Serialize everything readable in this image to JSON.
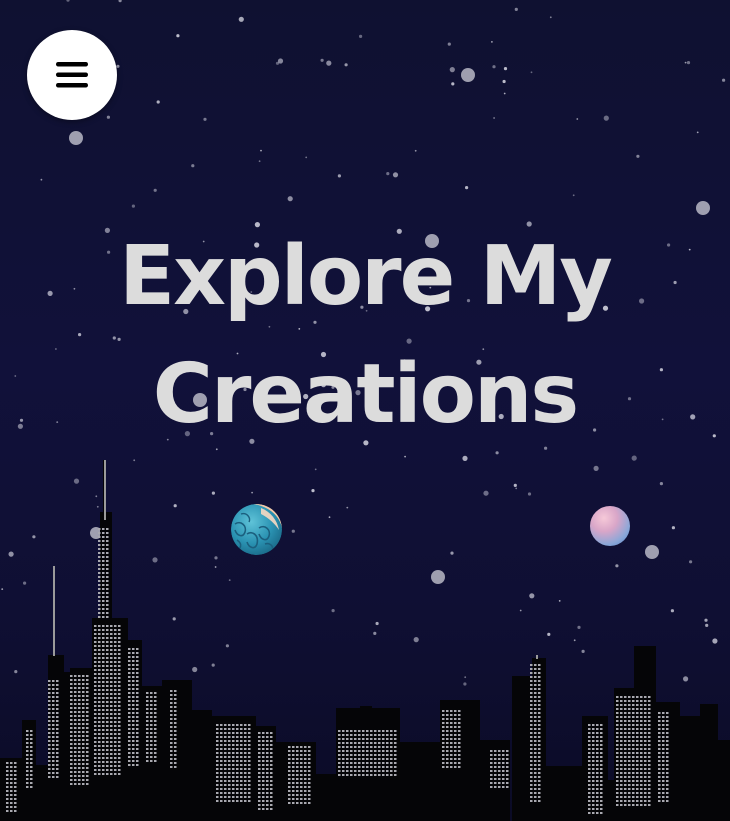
{
  "header": {
    "menu_icon": "hamburger-menu-icon"
  },
  "hero": {
    "headline_line1": "Explore My",
    "headline_line2": "Creations"
  },
  "decor": {
    "left_planet_icon": "earth-planet-icon",
    "right_planet_icon": "pink-planet-icon",
    "skyline_icon": "city-skyline-icon"
  },
  "colors": {
    "background": "#10102e",
    "headline": "#dcdcdc",
    "menu_button": "#ffffff",
    "skyline": "#000000"
  }
}
